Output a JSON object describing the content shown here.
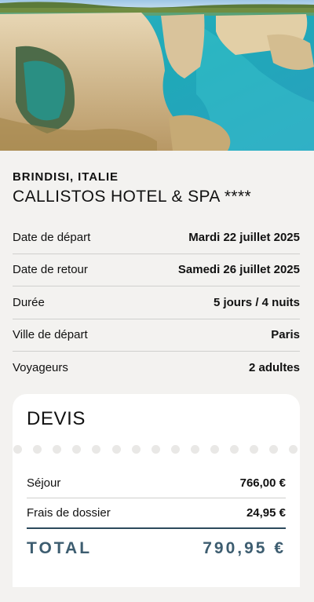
{
  "hero": {
    "image": "coastal-cliffs-turquoise-sea-photo"
  },
  "destination": {
    "location": "BRINDISI, ITALIE",
    "hotel": "CALLISTOS HOTEL & SPA ****"
  },
  "details": [
    {
      "label": "Date de départ",
      "value": "Mardi 22 juillet 2025"
    },
    {
      "label": "Date de retour",
      "value": "Samedi 26 juillet 2025"
    },
    {
      "label": "Durée",
      "value": "5 jours / 4 nuits"
    },
    {
      "label": "Ville de départ",
      "value": "Paris"
    },
    {
      "label": "Voyageurs",
      "value": "2 adultes"
    }
  ],
  "quote": {
    "title": "DEVIS",
    "lines": [
      {
        "label": "Séjour",
        "value": "766,00 €"
      },
      {
        "label": "Frais de dossier",
        "value": "24,95 €"
      }
    ],
    "total_label": "TOTAL",
    "total_value": "790,95 €",
    "accent_color": "#3d5d70"
  }
}
